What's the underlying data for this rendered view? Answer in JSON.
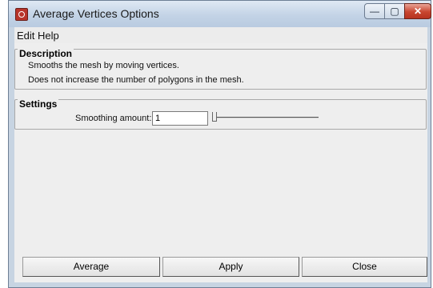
{
  "window": {
    "title": "Average Vertices Options",
    "controls": {
      "minimize": "—",
      "maximize": "▢",
      "close": "✕"
    }
  },
  "menu": {
    "items": [
      "Edit",
      "Help"
    ]
  },
  "description": {
    "title": "Description",
    "lines": [
      "Smooths the mesh by moving vertices.",
      "Does not increase the number of polygons in the mesh."
    ]
  },
  "settings": {
    "title": "Settings",
    "smoothing_label": "Smoothing amount:",
    "smoothing_value": "1",
    "slider_level": 0
  },
  "buttons": {
    "average": "Average",
    "apply": "Apply",
    "close": "Close"
  }
}
